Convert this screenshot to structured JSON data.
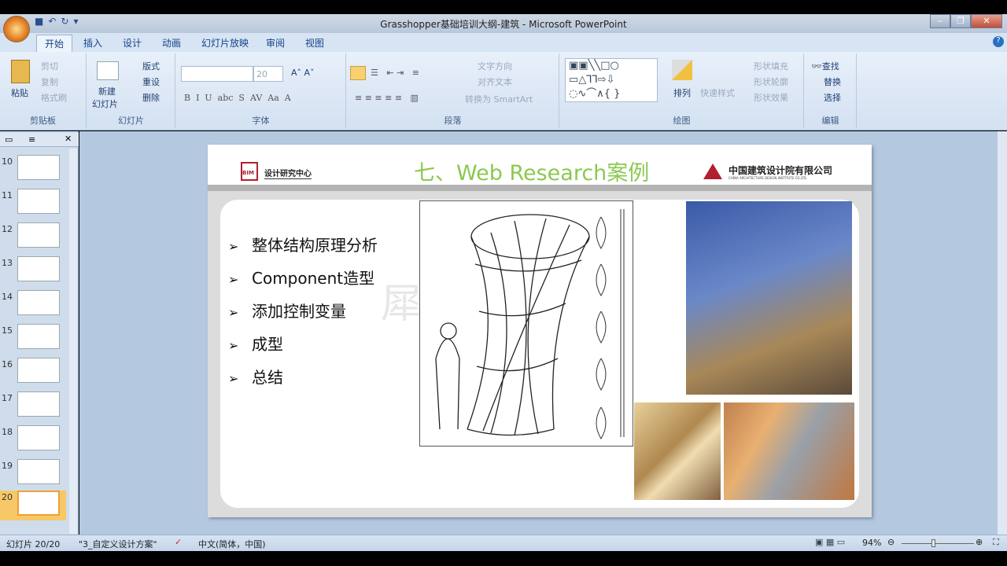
{
  "window": {
    "title": "Grasshopper基础培训大纲-建筑 - Microsoft PowerPoint"
  },
  "tabs": [
    "开始",
    "插入",
    "设计",
    "动画",
    "幻灯片放映",
    "审阅",
    "视图"
  ],
  "ribbon": {
    "clipboard": {
      "label": "剪贴板",
      "paste": "粘贴",
      "cut": "剪切",
      "copy": "复制",
      "format_painter": "格式刷"
    },
    "slides": {
      "label": "幻灯片",
      "new_slide": "新建",
      "new_slide2": "幻灯片",
      "layout": "版式",
      "reset": "重设",
      "delete": "删除"
    },
    "font": {
      "label": "字体",
      "font_name": "",
      "font_size": "20"
    },
    "paragraph": {
      "label": "段落",
      "text_direction": "文字方向",
      "align_text": "对齐文本",
      "smartart": "转换为 SmartArt"
    },
    "drawing": {
      "label": "绘图",
      "arrange": "排列",
      "quick_styles": "快速样式",
      "shape_fill": "形状填充",
      "shape_outline": "形状轮廓",
      "shape_effects": "形状效果"
    },
    "editing": {
      "label": "编辑",
      "find": "查找",
      "replace": "替换",
      "select": "选择"
    }
  },
  "thumbnails": [
    "10",
    "11",
    "12",
    "13",
    "14",
    "15",
    "16",
    "17",
    "18",
    "19",
    "20"
  ],
  "slide": {
    "logo_left": "设计研究中心",
    "logo_left_sub": "BIM",
    "title": "七、Web Research案例",
    "logo_right": "中国建筑设计院有限公司",
    "logo_right_sub": "CHINA ARCHITECTURE DESIGN INSTITUTE CO.LTD",
    "bullets": [
      "整体结构原理分析",
      "Component造型",
      "添加控制变量",
      "成型",
      "总结"
    ],
    "watermark": "犀牛参数化云"
  },
  "status": {
    "slide": "幻灯片 20/20",
    "theme": "\"3_自定义设计方案\"",
    "language": "中文(简体，中国)",
    "zoom": "94%"
  }
}
